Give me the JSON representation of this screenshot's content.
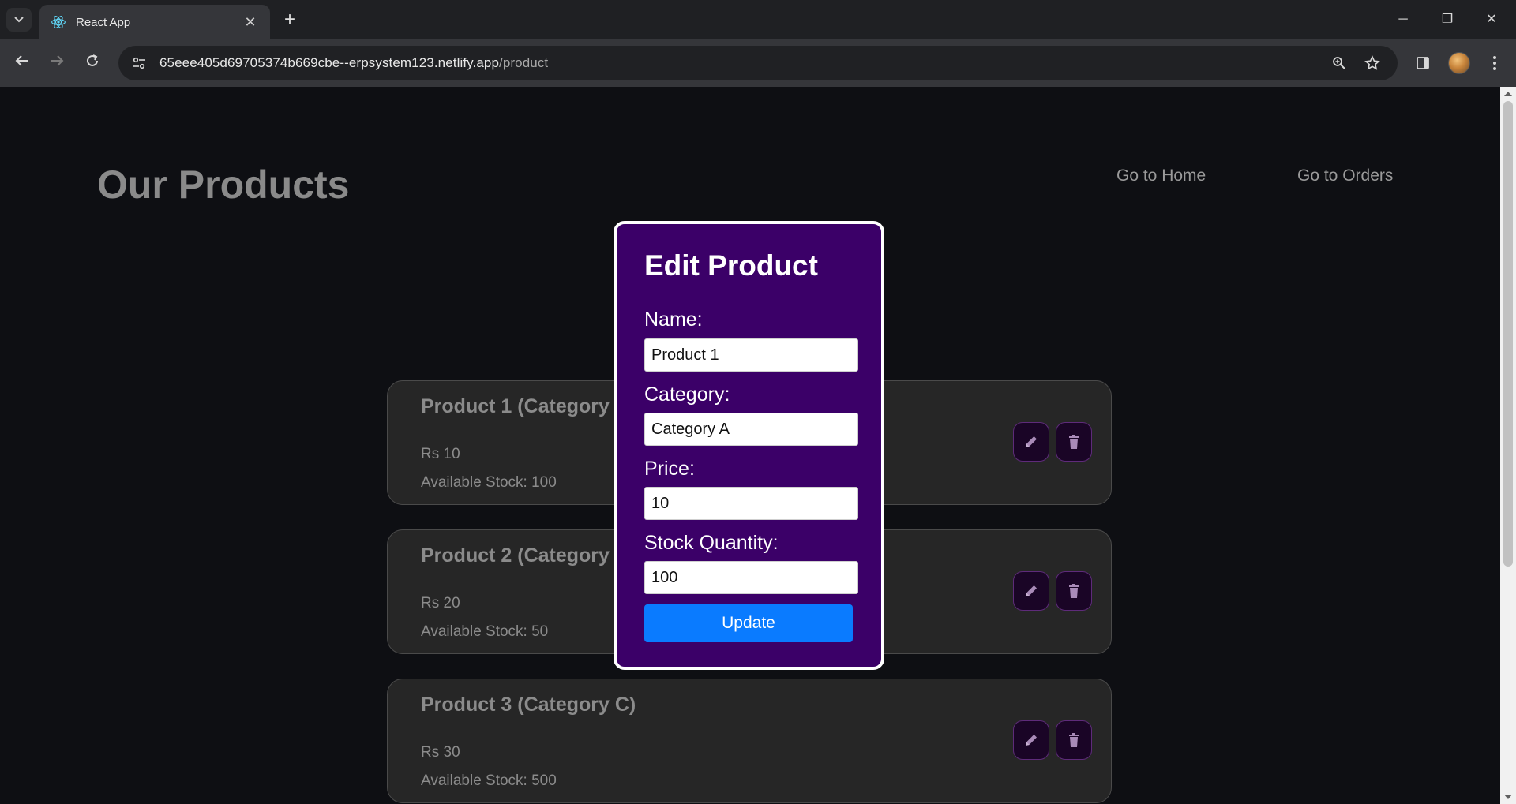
{
  "browser": {
    "tab_title": "React App",
    "url_host": "65eee405d69705374b669cbe--erpsystem123.netlify.app",
    "url_path": "/product"
  },
  "page": {
    "title": "Our Products",
    "nav": {
      "home": "Go to Home",
      "orders": "Go to Orders"
    }
  },
  "products": [
    {
      "title": "Product 1 (Category",
      "price": "Rs 10",
      "stock": "Available Stock: 100"
    },
    {
      "title": "Product 2 (Category",
      "price": "Rs 20",
      "stock": "Available Stock: 50"
    },
    {
      "title": "Product 3 (Category C)",
      "price": "Rs 30",
      "stock": "Available Stock: 500"
    }
  ],
  "modal": {
    "title": "Edit Product",
    "fields": [
      {
        "label": "Name:",
        "value": "Product 1"
      },
      {
        "label": "Category:",
        "value": "Category A"
      },
      {
        "label": "Price:",
        "value": "10"
      },
      {
        "label": "Stock Quantity:",
        "value": "100"
      }
    ],
    "submit_label": "Update"
  },
  "colors": {
    "modal_bg": "#3b0068",
    "button_primary": "#0a7bff",
    "card_bg": "#262626",
    "page_bg": "#0e0f13"
  }
}
